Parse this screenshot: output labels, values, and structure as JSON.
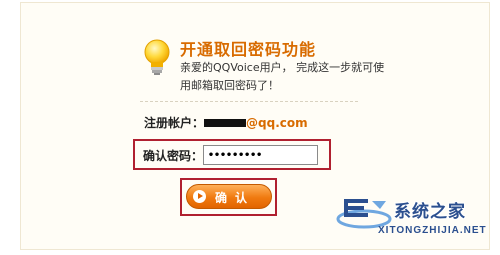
{
  "header": {
    "title": "开通取回密码功能",
    "description": "亲爱的QQVoice用户， 完成这一步就可使用邮箱取回密码了！",
    "icon": "lightbulb-icon"
  },
  "account": {
    "label": "注册帐户：",
    "domain": "@qq.com"
  },
  "password": {
    "label": "确认密码：",
    "value": "•••••••••"
  },
  "confirm_button": {
    "label": "确认",
    "icon": "play-arrow-icon"
  },
  "watermark": {
    "name": "系统之家",
    "url": "XITONGZHIJIA.NET"
  },
  "colors": {
    "accent": "#d86b00",
    "highlight_border": "#b02030",
    "button": "#f07a10",
    "watermark": "#2b4f8f"
  }
}
